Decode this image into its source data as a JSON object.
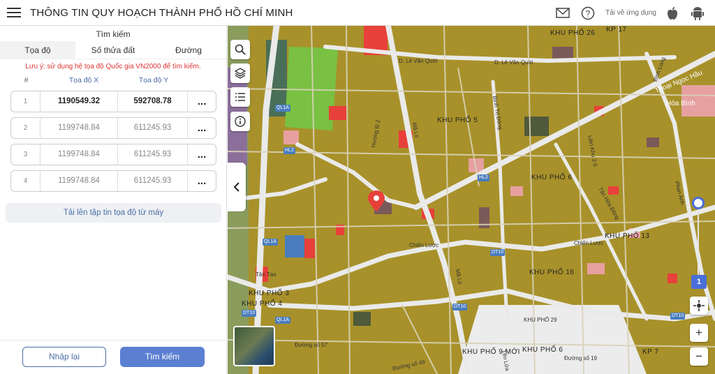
{
  "header": {
    "title": "THÔNG TIN QUY HOẠCH THÀNH PHỐ HỒ CHÍ MINH",
    "app_download": "Tải về ứng dụng"
  },
  "sidebar": {
    "search_title": "Tìm kiếm",
    "tabs": [
      {
        "label": "Tọa độ",
        "active": true
      },
      {
        "label": "Số thửa đất",
        "active": false
      },
      {
        "label": "Đường",
        "active": false
      }
    ],
    "note": "Lưu ý: sử dụng hệ tọa độ Quốc gia VN2000 để tìm kiếm.",
    "columns": {
      "index": "#",
      "x": "Tọa độ X",
      "y": "Tọa độ Y"
    },
    "rows": [
      {
        "index": "1",
        "x": "1190549.32",
        "y": "592708.78",
        "more": "..."
      },
      {
        "index": "2",
        "x": "1199748.84",
        "y": "611245.93",
        "more": "..."
      },
      {
        "index": "3",
        "x": "1199748.84",
        "y": "611245.93",
        "more": "..."
      },
      {
        "index": "4",
        "x": "1199748.84",
        "y": "611245.93",
        "more": "..."
      }
    ],
    "upload_label": "Tải lên tập tin tọa độ từ máy",
    "reset_label": "Nhập lại",
    "search_label": "Tìm kiếm"
  },
  "map": {
    "zoom_level": "1",
    "zoom_in": "+",
    "zoom_out": "−",
    "colors": {
      "residential": "#a8912a",
      "park": "#79c043",
      "commercial": "#e8403a",
      "water": "#4a7dbf",
      "road": "#eaeaea"
    },
    "labels": {
      "areas": [
        "KHU PHỐ 26",
        "KP 17",
        "KHU PHỐ 5",
        "KHU PHỐ 6",
        "KHU PHỐ 13",
        "KHU PHỐ 16",
        "KHU PHỐ 3",
        "KHU PHỐ 4",
        "KHU PHỐ 9 MỚI",
        "KHU PHỐ 6",
        "KP 7",
        "KHU PHỐ 29"
      ],
      "streets": [
        "D. Lê Văn Quới",
        "D. Lê Văn Quới",
        "Bình Long",
        "Thoại Ngọc Hầu",
        "Hòa Bình",
        "Bình Trị Đông",
        "Liên Khu 2-5",
        "Tân Hòa Đông",
        "Phan Anh",
        "Chiến Lược",
        "Chiến Lược",
        "Mã Lò",
        "Mã Lò",
        "Tên Lửa",
        "Đường số 57",
        "Đường số 49",
        "Đường số 19",
        "Tân Tạo",
        "Hương lộ 2"
      ],
      "shields": [
        "QL1A",
        "QL1A",
        "QL1A",
        "HL2",
        "HL2",
        "DT10",
        "DT10",
        "DT10",
        "DT10"
      ]
    }
  }
}
